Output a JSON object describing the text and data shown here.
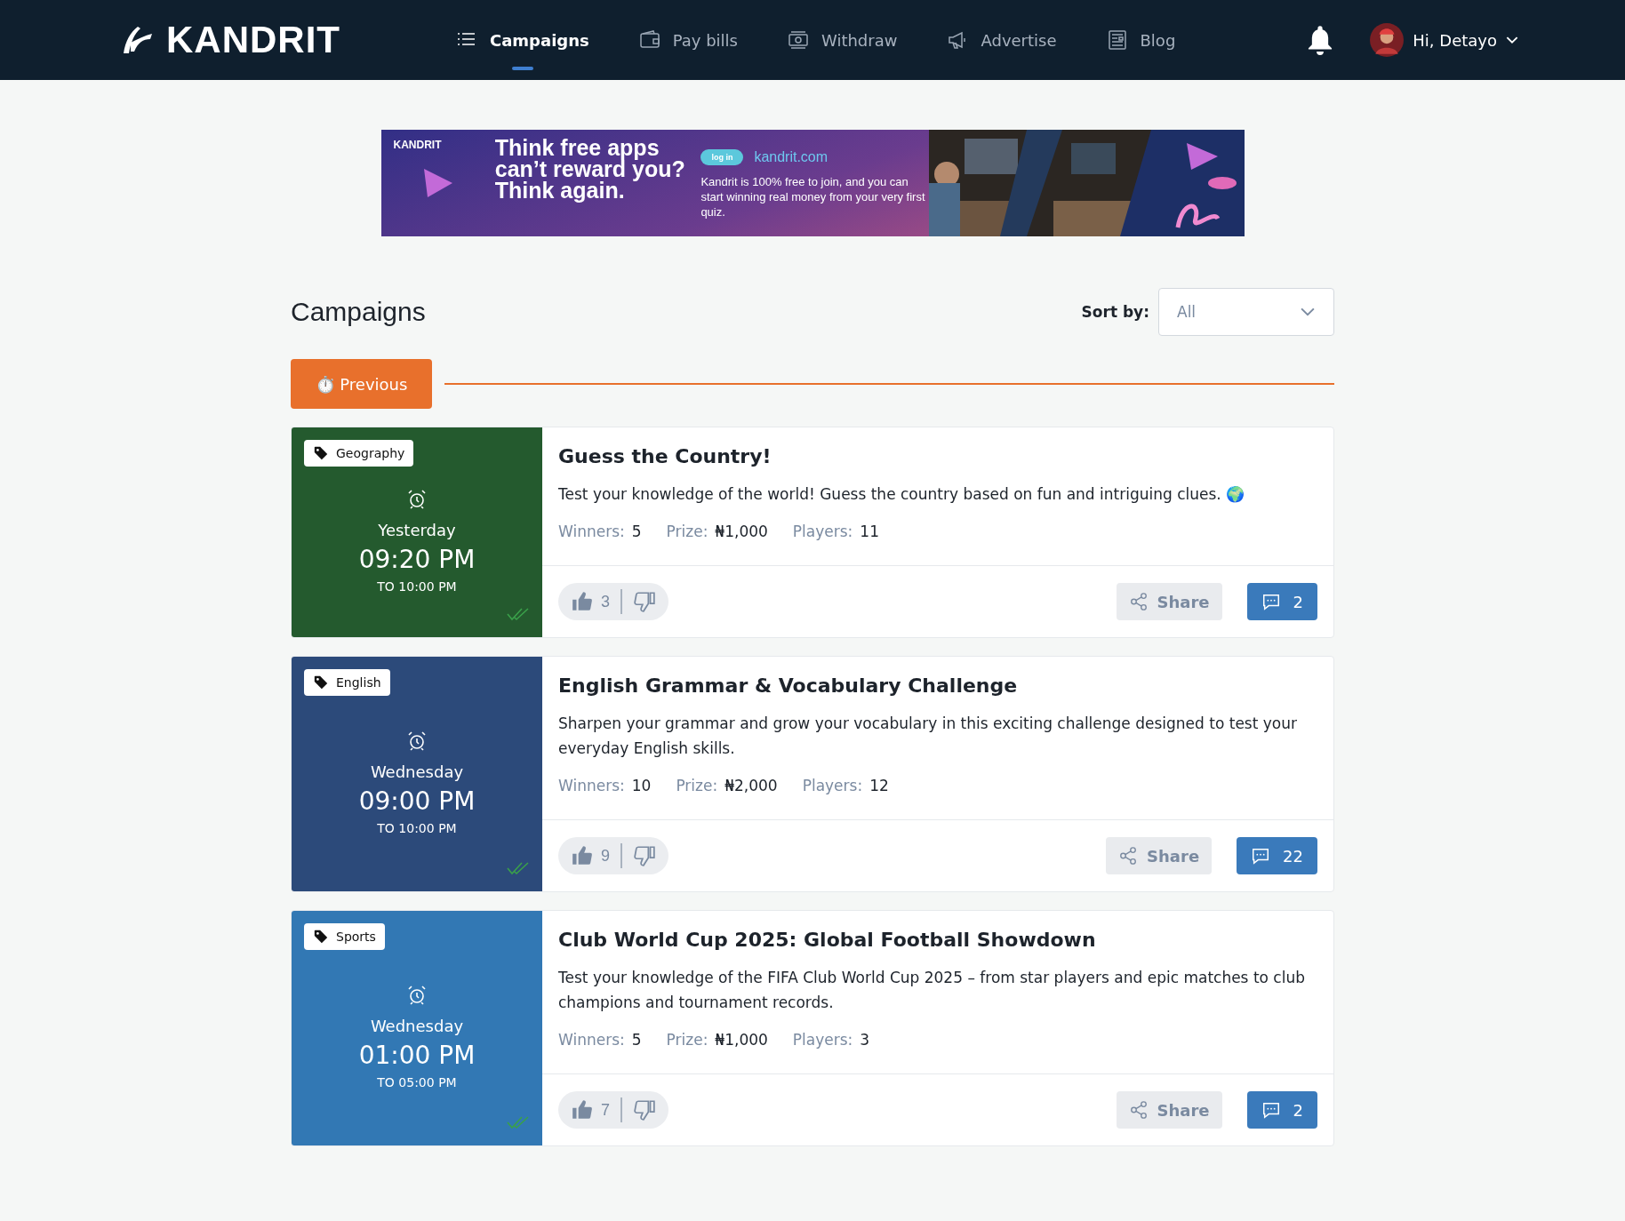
{
  "navbar": {
    "logo": "KANDRIT",
    "items": [
      {
        "label": "Campaigns",
        "kind": "list",
        "selected": true
      },
      {
        "label": "Pay bills",
        "kind": "wallet",
        "selected": false
      },
      {
        "label": "Withdraw",
        "kind": "cash",
        "selected": false
      },
      {
        "label": "Advertise",
        "kind": "megaphone",
        "selected": false
      },
      {
        "label": "Blog",
        "kind": "news",
        "selected": false
      }
    ],
    "greeting": "Hi, Detayo"
  },
  "banner": {
    "logo": "KANDRIT",
    "headline": "Think free apps can’t reward you? Think again.",
    "button": "log in",
    "link": "kandrit.com",
    "text": "Kandrit is 100% free to join, and you can start winning real money from your very first quiz."
  },
  "page": {
    "title": "Campaigns",
    "sort_label": "Sort by:",
    "sort_value": "All",
    "filter_button": "⏱️ Previous"
  },
  "campaigns": [
    {
      "category": "Geography",
      "color": "#245a2e",
      "day": "Yesterday",
      "time": "09:20 PM",
      "to": "TO 10:00 PM",
      "completed": true,
      "title": "Guess the Country!",
      "description": "Test your knowledge of the world! Guess the country based on fun and intriguing clues. 🌍",
      "winners_label": "Winners:",
      "winners": "5",
      "prize_label": "Prize:",
      "prize": "₦1,000",
      "players_label": "Players:",
      "players": "11",
      "likes": "3",
      "share": "Share",
      "comments": "2"
    },
    {
      "category": "English",
      "color": "#2c4a7a",
      "day": "Wednesday",
      "time": "09:00 PM",
      "to": "TO 10:00 PM",
      "completed": true,
      "title": "English Grammar & Vocabulary Challenge",
      "description": "Sharpen your grammar and grow your vocabulary in this exciting challenge designed to test your everyday English skills.",
      "winners_label": "Winners:",
      "winners": "10",
      "prize_label": "Prize:",
      "prize": "₦2,000",
      "players_label": "Players:",
      "players": "12",
      "likes": "9",
      "share": "Share",
      "comments": "22"
    },
    {
      "category": "Sports",
      "color": "#3278b4",
      "day": "Wednesday",
      "time": "01:00 PM",
      "to": "TO 05:00 PM",
      "completed": true,
      "title": "Club World Cup 2025: Global Football Showdown",
      "description": "Test your knowledge of the FIFA Club World Cup 2025 – from star players and epic matches to club champions and tournament records.",
      "winners_label": "Winners:",
      "winners": "5",
      "prize_label": "Prize:",
      "prize": "₦1,000",
      "players_label": "Players:",
      "players": "3",
      "likes": "7",
      "share": "Share",
      "comments": "2"
    }
  ]
}
